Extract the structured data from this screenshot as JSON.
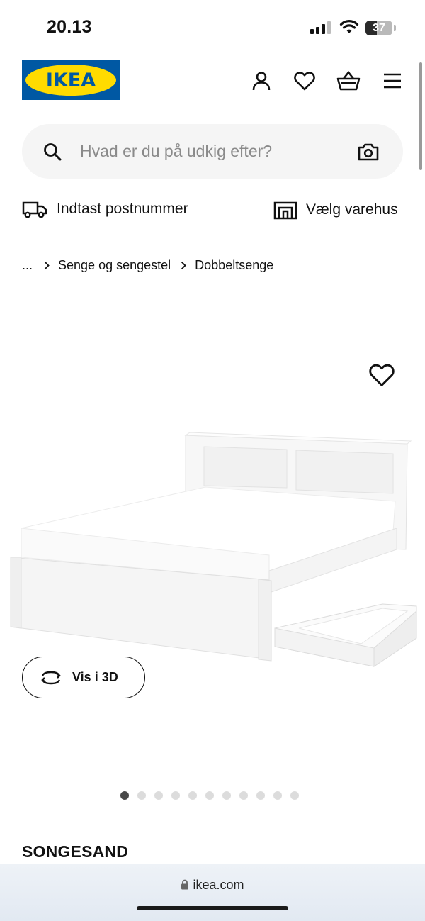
{
  "status_bar": {
    "time": "20.13",
    "battery": "37"
  },
  "header": {
    "logo_text": "IKEA",
    "icons": [
      "user-icon",
      "heart-icon",
      "basket-icon",
      "menu-icon"
    ]
  },
  "search": {
    "placeholder": "Hvad er du på udkig efter?"
  },
  "delivery": {
    "postcode_label": "Indtast postnummer",
    "store_label": "Vælg varehus"
  },
  "breadcrumb": {
    "ellipsis": "...",
    "items": [
      "Senge og sengestel",
      "Dobbeltsenge"
    ]
  },
  "product": {
    "view_3d_label": "Vis i 3D",
    "image_count": 11,
    "active_image": 1,
    "name": "SONGESAND"
  },
  "browser": {
    "url": "ikea.com"
  },
  "colors": {
    "ikea_blue": "#0058a3",
    "ikea_yellow": "#ffdb00",
    "search_bg": "#f5f5f5",
    "dot_active": "#484848",
    "dot_inactive": "#dcdcdc"
  }
}
